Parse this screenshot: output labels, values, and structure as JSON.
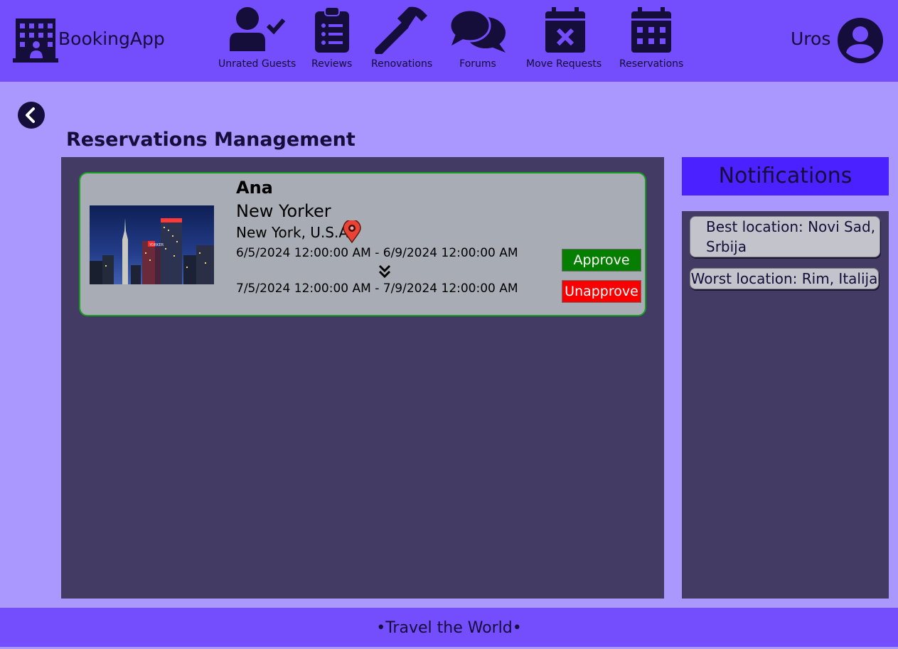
{
  "app": {
    "title": "BookingApp"
  },
  "nav": [
    {
      "label": "Unrated Guests",
      "icon": "user-check-icon"
    },
    {
      "label": "Reviews",
      "icon": "clipboard-list-icon"
    },
    {
      "label": "Renovations",
      "icon": "hammer-icon"
    },
    {
      "label": "Forums",
      "icon": "chat-bubbles-icon"
    },
    {
      "label": "Move Requests",
      "icon": "calendar-x-icon"
    },
    {
      "label": "Reservations",
      "icon": "calendar-grid-icon"
    }
  ],
  "user": {
    "name": "Uros",
    "icon": "user-circle-icon"
  },
  "page": {
    "title": "Reservations Management",
    "back_icon": "chevron-left-circle-icon"
  },
  "reservation": {
    "guest": "Ana",
    "accommodation": "New Yorker",
    "location": "New York, U.S.A",
    "old_dates": "6/5/2024 12:00:00 AM - 6/9/2024 12:00:00 AM",
    "new_dates": "7/5/2024 12:00:00 AM - 7/9/2024 12:00:00 AM",
    "approve_label": "Approve",
    "unapprove_label": "Unapprove"
  },
  "notifications": {
    "title": "Notifications",
    "items": [
      "Best location: Novi Sad, Srbija",
      "Worst location: Rim, Italija"
    ]
  },
  "footer": {
    "text": "•Travel the World•"
  },
  "colors": {
    "header_bg": "#744dfd",
    "page_bg": "#ab98ff",
    "panel_bg": "#433b63",
    "approve": "#067f00",
    "unapprove": "#f80000",
    "notif_header": "#4b22ff"
  }
}
